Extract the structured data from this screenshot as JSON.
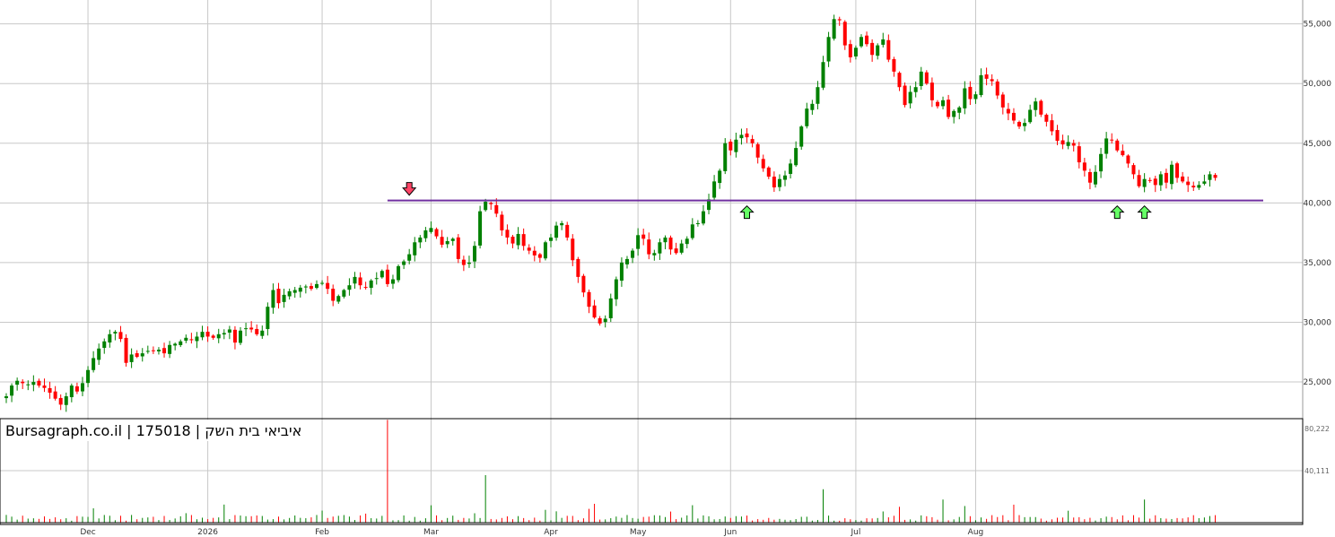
{
  "chart_data": {
    "type": "candlestick",
    "title": "Bursagraph.co.il | 175018 | איביאי בית השק",
    "y_axis": {
      "min": 22000,
      "max": 57000,
      "ticks": [
        25000,
        30000,
        35000,
        40000,
        45000,
        50000,
        55000
      ],
      "tick_labels": [
        "25,000",
        "30,000",
        "35,000",
        "40,000",
        "45,000",
        "50,000",
        "55,000"
      ],
      "position": "right"
    },
    "volume_axis": {
      "max": 80222,
      "tick_labels": [
        "80,222",
        "40,111"
      ]
    },
    "x_axis": {
      "labels": [
        "Dec",
        "2026",
        "Feb",
        "Mar",
        "Apr",
        "May",
        "Jun",
        "Jul",
        "Aug"
      ]
    },
    "grid": true,
    "support_level": 40200,
    "colors": {
      "up": "#008000",
      "down": "#ff0000",
      "support": "#7030a0",
      "arrow_up": "#66ff66",
      "arrow_down": "#ff4466",
      "grid": "#c8c8c8"
    },
    "markers": [
      {
        "type": "sell-arrow",
        "date_index": 74
      },
      {
        "type": "buy-arrow",
        "date_index": 136
      },
      {
        "type": "buy-arrow",
        "date_index": 204
      },
      {
        "type": "buy-arrow",
        "date_index": 209
      }
    ],
    "month_starts": [
      15,
      37,
      58,
      78,
      100,
      116,
      133,
      156,
      178
    ],
    "closes": [
      23800,
      24700,
      25100,
      24900,
      24800,
      25000,
      24700,
      24500,
      24100,
      23600,
      23100,
      23800,
      24700,
      24200,
      24900,
      26000,
      27000,
      27800,
      28400,
      29000,
      29200,
      28600,
      26600,
      27300,
      27100,
      27400,
      27600,
      27600,
      27700,
      27400,
      28100,
      28200,
      28400,
      28700,
      28500,
      28800,
      29200,
      28800,
      28700,
      29000,
      29100,
      29400,
      28300,
      29300,
      29500,
      29400,
      29000,
      29300,
      31300,
      32700,
      31600,
      32300,
      32600,
      32700,
      32900,
      33000,
      32800,
      33200,
      33300,
      32800,
      31800,
      32200,
      32700,
      33100,
      33800,
      33100,
      32900,
      33500,
      33700,
      34300,
      33200,
      33600,
      34700,
      35100,
      35700,
      36700,
      37100,
      37700,
      37900,
      37200,
      36500,
      36800,
      37000,
      35300,
      34800,
      35000,
      36400,
      39300,
      40100,
      39900,
      39100,
      37700,
      37100,
      36600,
      37400,
      36400,
      36000,
      35600,
      35400,
      36700,
      37100,
      38100,
      38300,
      37100,
      35200,
      33800,
      32500,
      31300,
      30400,
      29900,
      30300,
      32000,
      33600,
      35000,
      35300,
      36000,
      37300,
      37000,
      35700,
      35800,
      36700,
      37100,
      36100,
      35800,
      36600,
      37000,
      38200,
      38300,
      39300,
      40300,
      41800,
      42700,
      45000,
      44400,
      45300,
      45700,
      45500,
      45000,
      43800,
      42900,
      42200,
      41300,
      42000,
      42300,
      43300,
      44600,
      46400,
      47900,
      48300,
      49700,
      51800,
      53900,
      55400,
      55300,
      53200,
      52200,
      53000,
      53900,
      53300,
      52400,
      53200,
      53700,
      52000,
      51000,
      49700,
      48200,
      49300,
      49700,
      51000,
      50000,
      48600,
      48100,
      48600,
      47200,
      47700,
      48000,
      49600,
      48700,
      49100,
      50700,
      50400,
      50200,
      49000,
      48000,
      47500,
      46900,
      46400,
      46700,
      47800,
      48500,
      47400,
      46800,
      46000,
      45200,
      44900,
      45100,
      44800,
      43400,
      42700,
      41700,
      42600,
      44100,
      45400,
      45300,
      44400,
      44000,
      43300,
      42400,
      41400,
      42000,
      41900,
      41500,
      42400,
      41700,
      43200,
      42100,
      41800,
      41500,
      41300,
      41500,
      41800,
      42400,
      42100
    ]
  }
}
